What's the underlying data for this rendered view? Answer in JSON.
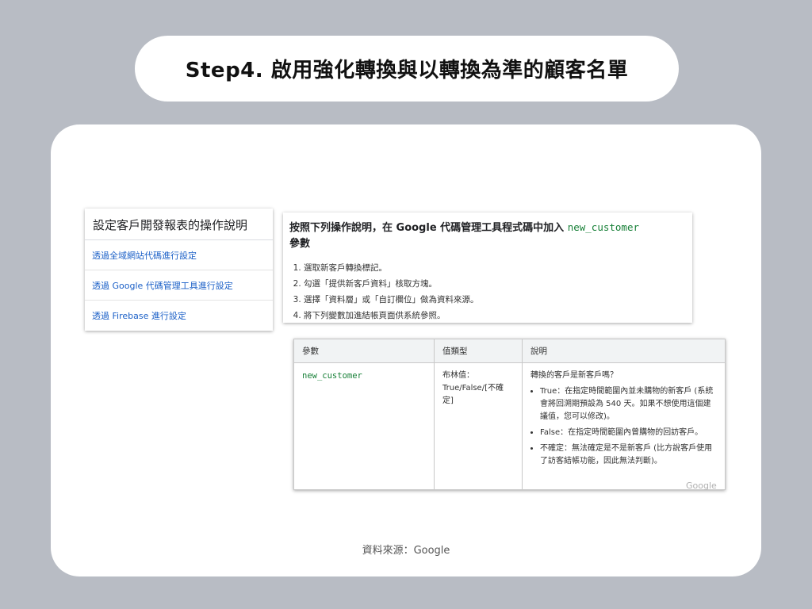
{
  "title": "Step4. 啟用強化轉換與以轉換為準的顧客名單",
  "left_panel": {
    "title": "設定客戶開發報表的操作說明",
    "links": [
      "透過全域網站代碼進行設定",
      "透過 Google 代碼管理工具進行設定",
      "透過 Firebase 進行設定"
    ]
  },
  "instructions": {
    "heading": "按照下列操作說明，在 Google 代碼管理工具程式碼中加入",
    "heading_code": "new_customer",
    "heading_suffix": "參數",
    "steps": [
      "選取新客戶轉換標記。",
      "勾選「提供新客戶資料」核取方塊。",
      "選擇「資料層」或「自訂欄位」做為資料來源。",
      "將下列變數加進結帳頁面供系統參照。"
    ]
  },
  "table": {
    "headers": [
      "參數",
      "值類型",
      "說明"
    ],
    "param": "new_customer",
    "value_type": "布林值：True/False/[不確定]",
    "desc_intro": "轉換的客戶是新客戶嗎？",
    "desc_items": [
      "True：在指定時間範圍內並未購物的新客戶 (系統會將回溯期預設為 540 天。如果不想使用這個建議值，您可以修改)。",
      "False：在指定時間範圍內曾購物的回訪客戶。",
      "不確定：無法確定是不是新客戶 (比方說客戶使用了訪客結帳功能，因此無法判斷)。"
    ]
  },
  "watermark": "Google",
  "source": "資料來源：Google"
}
